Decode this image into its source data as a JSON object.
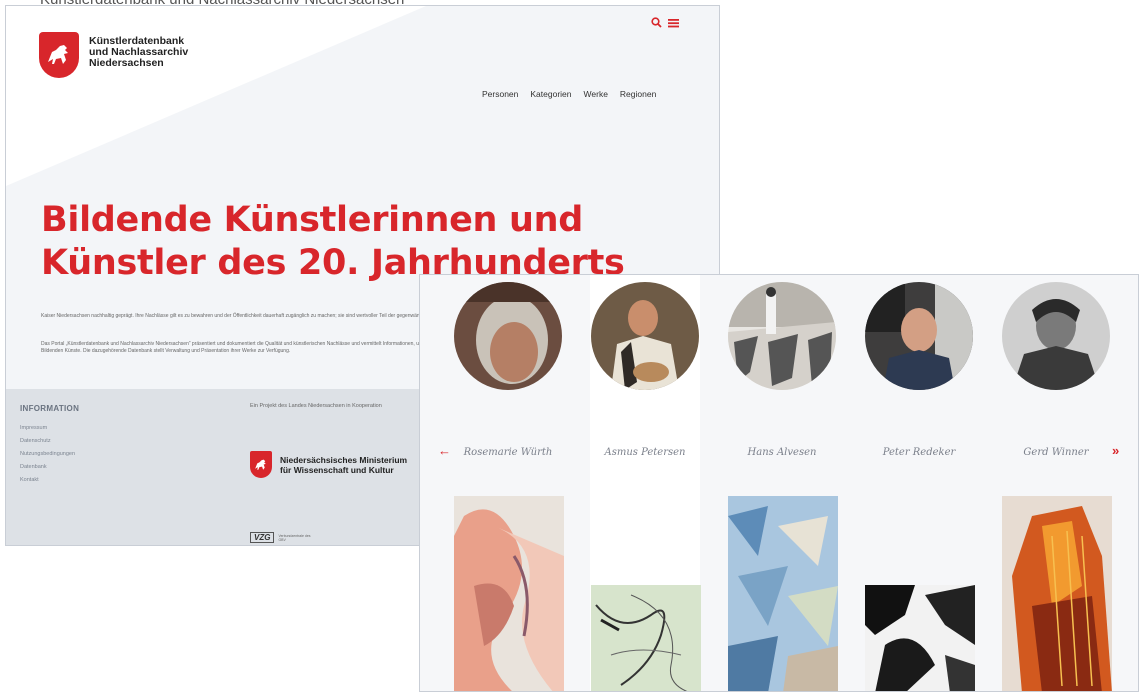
{
  "cut_text": "Künstlerdatenbank und Nachlassarchiv Niedersachsen",
  "back": {
    "brand": [
      "Künstlerdatenbank",
      "und Nachlassarchiv",
      "Niedersachsen"
    ],
    "nav": [
      "Personen",
      "Kategorien",
      "Werke",
      "Regionen"
    ],
    "hero": [
      "Bildende Künstlerinnen und",
      "Künstler des 20. Jahrhunderts"
    ],
    "para1": "Kaiser Niedersachsen nachhaltig geprägt. Ihre Nachlässe gilt es zu bewahren und der Öffentlichkeit dauerhaft zugänglich zu machen; sie sind wertvoller Teil der gegenwärtigen Kultur des Landes Niedersachsen.",
    "para2": "Das Portal „Künstlerdatenbank und Nachlassarchiv Niedersachsen“ präsentiert und dokumentiert die Qualität und künstlerischen Nachlässe und vermittelt Informationen, unterstützt die Forschung und Vernetzung und leistet so einen wichtigen Beitrag zur Sichtbarmachung und Einordnung der Bildenden Künste. Die dazugehörende Datenbank stellt Verwaltung und Präsentation ihrer Werke zur Verfügung.",
    "footer": {
      "info_head": "INFORMATION",
      "links": [
        "Impressum",
        "Datenschutz",
        "Nutzungsbedingungen",
        "Datenbank",
        "Kontakt"
      ],
      "project_text": "Ein Projekt des Landes Niedersachsen in Kooperation",
      "ministry": [
        "Niedersächsisches Ministerium",
        "für Wissenschaft und Kultur"
      ],
      "vzg_logo": "VZG",
      "vzg_text": "Verbundzentrale des GBV"
    }
  },
  "front": {
    "artists": [
      {
        "name": "Rosemarie Würth",
        "selected": false
      },
      {
        "name": "Asmus Petersen",
        "selected": true
      },
      {
        "name": "Hans Alvesen",
        "selected": false
      },
      {
        "name": "Peter Redeker",
        "selected": false
      },
      {
        "name": "Gerd Winner",
        "selected": false
      }
    ],
    "prev_arrow": "←",
    "next_arrow": "»"
  },
  "colors": {
    "accent": "#d8262b",
    "back_bg": "#f3f5f8",
    "footer_bg": "#dde1e6",
    "front_bg": "#f6f7f9"
  },
  "icons": [
    "search-icon",
    "menu-icon",
    "crest-icon",
    "arrow-left-icon",
    "arrow-right-icon"
  ]
}
